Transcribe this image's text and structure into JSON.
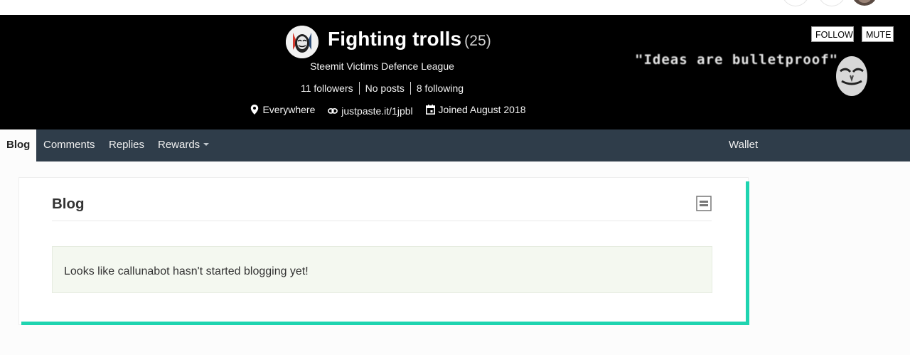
{
  "profile": {
    "name": "Fighting trolls",
    "reputation": "(25)",
    "about": "Steemit Victims Defence League",
    "followers": "11 followers",
    "posts": "No posts",
    "following": "8 following",
    "location": "Everywhere",
    "website": "justpaste.it/1jpbl",
    "joined": "Joined August 2018",
    "follow_label": "FOLLOW",
    "mute_label": "MUTE",
    "cover_text": "\"Ideas are bulletproof\""
  },
  "nav": {
    "tabs": [
      "Blog",
      "Comments",
      "Replies",
      "Rewards"
    ],
    "wallet": "Wallet"
  },
  "content": {
    "heading": "Blog",
    "empty_message": "Looks like callunabot hasn't started blogging yet!"
  },
  "colors": {
    "header_bg": "#000000",
    "nav_bg": "#2f3d4a",
    "accent": "#1fd4b0"
  },
  "icons": [
    "location-pin-icon",
    "link-icon",
    "calendar-icon",
    "layout-toggle-icon",
    "dropdown-caret-icon"
  ]
}
